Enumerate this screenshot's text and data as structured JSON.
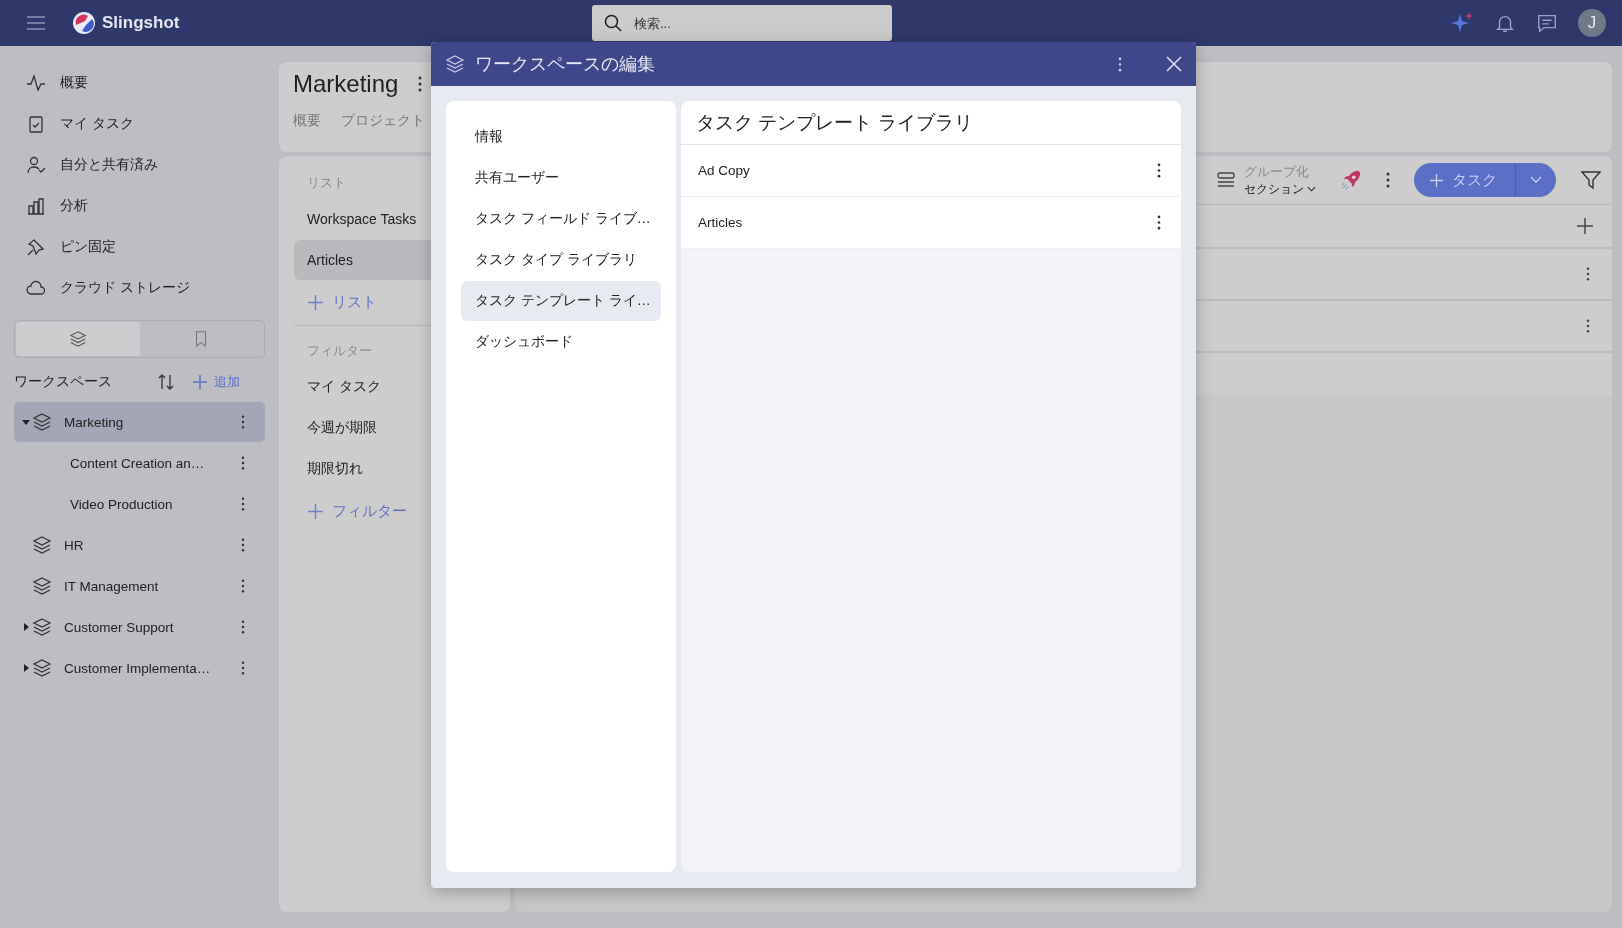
{
  "app": {
    "name": "Slingshot"
  },
  "search": {
    "placeholder": "検索..."
  },
  "user": {
    "initial": "J"
  },
  "nav": [
    {
      "label": "概要"
    },
    {
      "label": "マイ タスク"
    },
    {
      "label": "自分と共有済み"
    },
    {
      "label": "分析"
    },
    {
      "label": "ピン固定"
    },
    {
      "label": "クラウド ストレージ"
    }
  ],
  "sidebar_tabs": [
    {
      "selected": true
    },
    {
      "selected": false
    }
  ],
  "workspaces": {
    "title": "ワークスペース",
    "add_label": "追加",
    "items": [
      {
        "name": "Marketing",
        "selected": true,
        "expanded": true,
        "children": [
          {
            "name": "Content Creation an…",
            "selected": false
          },
          {
            "name": "Video Production",
            "selected": false
          }
        ]
      },
      {
        "name": "HR",
        "selected": false
      },
      {
        "name": "IT Management",
        "selected": false
      },
      {
        "name": "Customer Support",
        "selected": false,
        "expanded": false
      },
      {
        "name": "Customer Implementa…",
        "selected": false,
        "expanded": false
      }
    ]
  },
  "workspace_header": {
    "title": "Marketing",
    "tabs": [
      {
        "label": "概要"
      },
      {
        "label": "プロジェクト"
      }
    ]
  },
  "lists": {
    "heading": "リスト",
    "add_label": "リスト",
    "items": [
      {
        "label": "Workspace Tasks",
        "selected": false
      },
      {
        "label": "Articles",
        "selected": true
      }
    ]
  },
  "filters": {
    "heading": "フィルター",
    "add_label": "フィルター",
    "items": [
      {
        "label": "マイ タスク"
      },
      {
        "label": "今週が期限"
      },
      {
        "label": "期限切れ"
      }
    ]
  },
  "toolbar": {
    "group_label": "グループ化",
    "group_value": "セクション",
    "task_button": "タスク"
  },
  "dialog": {
    "title": "ワークスペースの編集",
    "nav": [
      {
        "label": "情報",
        "selected": false
      },
      {
        "label": "共有ユーザー",
        "selected": false
      },
      {
        "label": "タスク フィールド ライブ…",
        "selected": false
      },
      {
        "label": "タスク タイプ ライブラリ",
        "selected": false
      },
      {
        "label": "タスク テンプレート ライ…",
        "selected": true
      },
      {
        "label": "ダッシュボード",
        "selected": false
      }
    ],
    "panel_title": "タスク テンプレート ライブラリ",
    "templates": [
      {
        "name": "Ad Copy"
      },
      {
        "name": "Articles"
      }
    ]
  }
}
